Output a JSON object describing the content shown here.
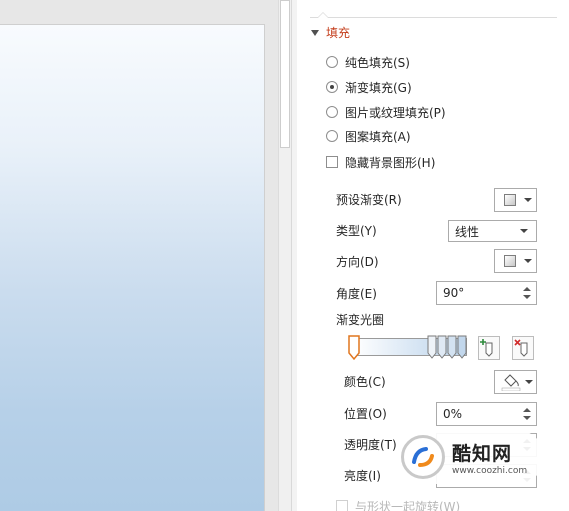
{
  "fill_section": {
    "title": "填充",
    "options": [
      {
        "label": "纯色填充(S)",
        "checked": false
      },
      {
        "label": "渐变填充(G)",
        "checked": true
      },
      {
        "label": "图片或纹理填充(P)",
        "checked": false
      },
      {
        "label": "图案填充(A)",
        "checked": false
      }
    ],
    "hide_bg_checkbox": {
      "label": "隐藏背景图形(H)",
      "checked": false
    }
  },
  "gradient": {
    "preset_label": "预设渐变(R)",
    "type_label": "类型(Y)",
    "type_value": "线性",
    "direction_label": "方向(D)",
    "angle_label": "角度(E)",
    "angle_value": "90°",
    "stops_label": "渐变光圈",
    "color_label": "颜色(C)",
    "position_label": "位置(O)",
    "position_value": "0%",
    "transparency_label": "透明度(T)",
    "brightness_label": "亮度(I)",
    "rotate_checkbox": {
      "label": "与形状一起旋转(W)",
      "checked": false,
      "disabled": true
    }
  },
  "watermark": {
    "brand": "酷知网",
    "url": "www.coozhi.com"
  },
  "colors": {
    "accent": "#c43e1c",
    "slide_top": "#f8fbfe",
    "slide_bottom": "#aecbe5"
  }
}
